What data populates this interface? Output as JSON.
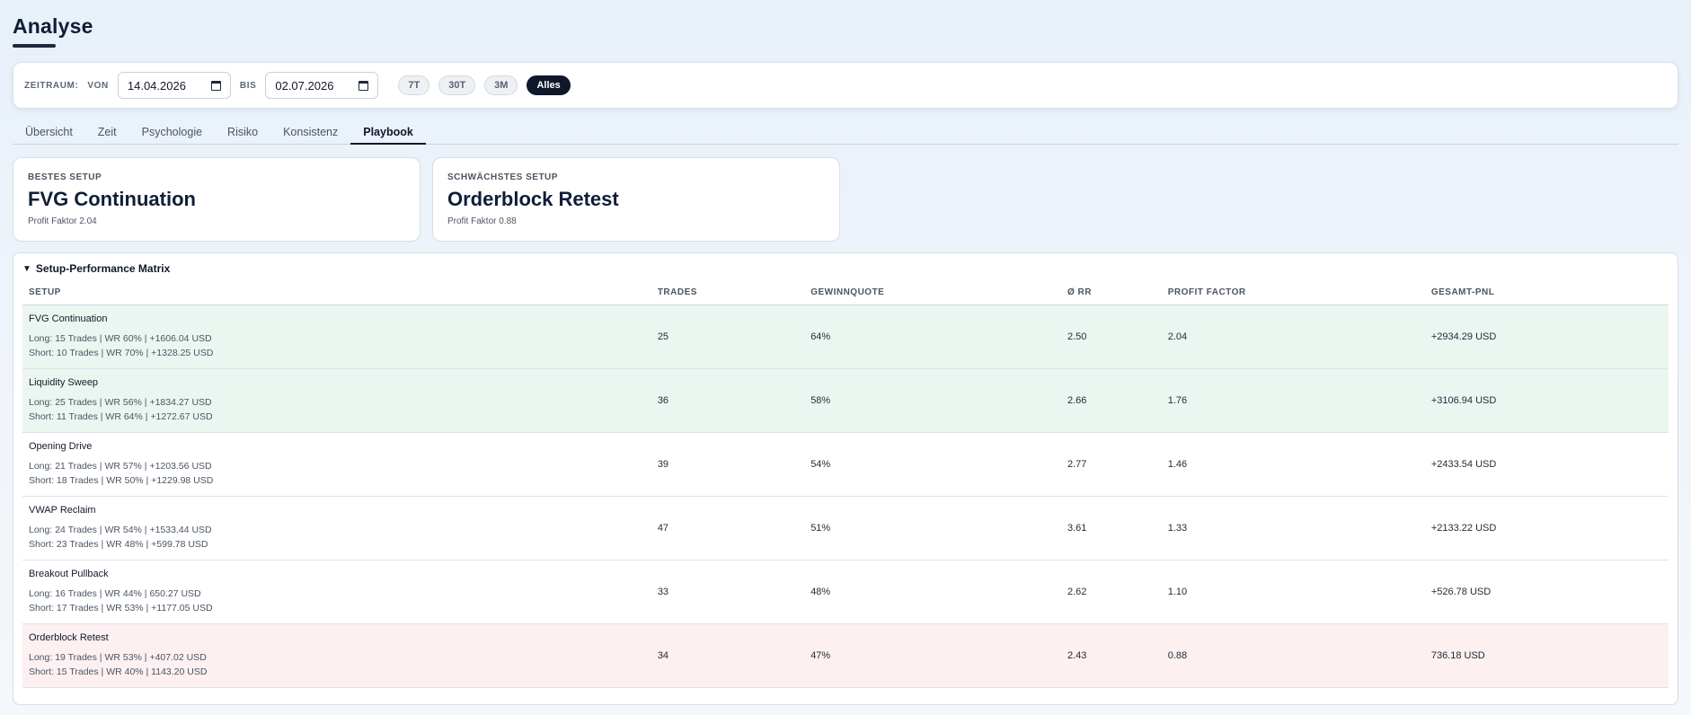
{
  "page": {
    "title": "Analyse"
  },
  "filter": {
    "zeitraum_label": "ZEITRAUM:",
    "von_label": "VON",
    "von_value": "14.04.2026",
    "bis_label": "BIS",
    "bis_value": "02.07.2026",
    "presets": [
      "7T",
      "30T",
      "3M",
      "Alles"
    ],
    "active_preset": "Alles"
  },
  "tabs": [
    "Übersicht",
    "Zeit",
    "Psychologie",
    "Risiko",
    "Konsistenz",
    "Playbook"
  ],
  "active_tab": "Playbook",
  "cards": {
    "best": {
      "label": "BESTES SETUP",
      "name": "FVG Continuation",
      "sub": "Profit Faktor 2.04"
    },
    "worst": {
      "label": "SCHWÄCHSTES SETUP",
      "name": "Orderblock Retest",
      "sub": "Profit Faktor 0.88"
    }
  },
  "matrix": {
    "title": "Setup-Performance Matrix",
    "headers": [
      "SETUP",
      "TRADES",
      "GEWINNQUOTE",
      "Ø RR",
      "PROFIT FACTOR",
      "GESAMT-PNL"
    ],
    "rows": [
      {
        "name": "FVG Continuation",
        "long": "Long: 15 Trades | WR 60% | +1606.04 USD",
        "short": "Short: 10 Trades | WR 70% | +1328.25 USD",
        "trades": "25",
        "winrate": "64%",
        "rr": "2.50",
        "pf": "2.04",
        "pnl": "+2934.29 USD"
      },
      {
        "name": "Liquidity Sweep",
        "long": "Long: 25 Trades | WR 56% | +1834.27 USD",
        "short": "Short: 11 Trades | WR 64% | +1272.67 USD",
        "trades": "36",
        "winrate": "58%",
        "rr": "2.66",
        "pf": "1.76",
        "pnl": "+3106.94 USD"
      },
      {
        "name": "Opening Drive",
        "long": "Long: 21 Trades | WR 57% | +1203.56 USD",
        "short": "Short: 18 Trades | WR 50% | +1229.98 USD",
        "trades": "39",
        "winrate": "54%",
        "rr": "2.77",
        "pf": "1.46",
        "pnl": "+2433.54 USD"
      },
      {
        "name": "VWAP Reclaim",
        "long": "Long: 24 Trades | WR 54% | +1533.44 USD",
        "short": "Short: 23 Trades | WR 48% | +599.78 USD",
        "trades": "47",
        "winrate": "51%",
        "rr": "3.61",
        "pf": "1.33",
        "pnl": "+2133.22 USD"
      },
      {
        "name": "Breakout Pullback",
        "long": "Long: 16 Trades | WR 44% | 650.27 USD",
        "short": "Short: 17 Trades | WR 53% | +1177.05 USD",
        "trades": "33",
        "winrate": "48%",
        "rr": "2.62",
        "pf": "1.10",
        "pnl": "+526.78 USD"
      },
      {
        "name": "Orderblock Retest",
        "long": "Long: 19 Trades | WR 53% | +407.02 USD",
        "short": "Short: 15 Trades | WR 40% | 1143.20 USD",
        "trades": "34",
        "winrate": "47%",
        "rr": "2.43",
        "pf": "0.88",
        "pnl": "736.18 USD"
      }
    ]
  },
  "colors": {
    "best_row_bg": "#ecf6f1",
    "worst_row_bg": "#fdf0f0",
    "active_dark": "#0f172a"
  }
}
